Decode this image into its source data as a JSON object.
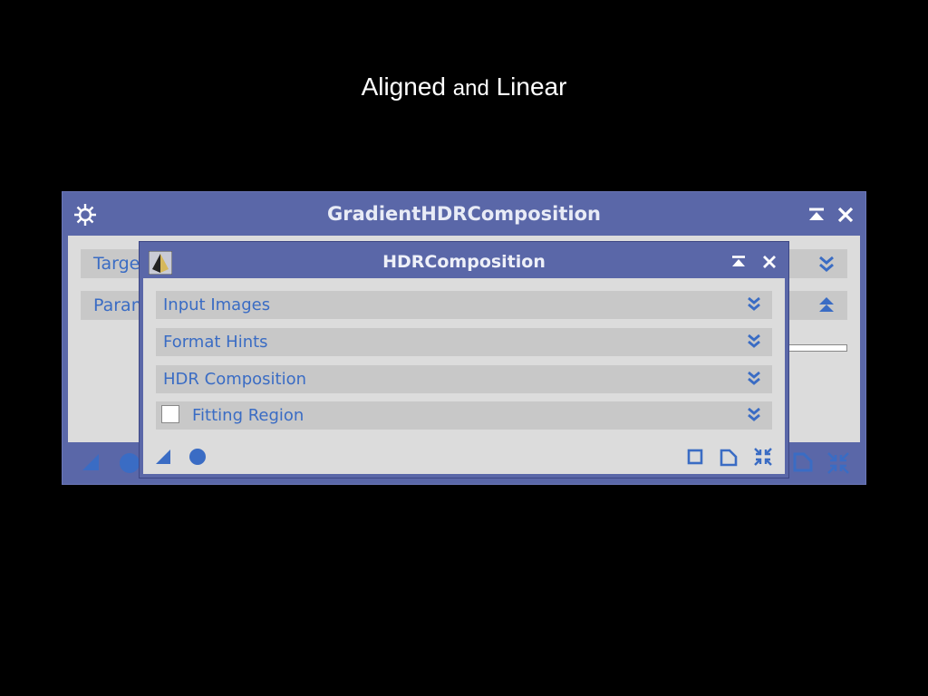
{
  "slide": {
    "title_part1": "Aligned",
    "title_part2": "and",
    "title_part3": "Linear"
  },
  "back_window": {
    "title": "GradientHDRComposition",
    "sections": [
      {
        "label": "Target"
      },
      {
        "label": "Param"
      }
    ]
  },
  "front_window": {
    "title": "HDRComposition",
    "sections": [
      {
        "label": "Input Images"
      },
      {
        "label": "Format Hints"
      },
      {
        "label": "HDR Composition"
      },
      {
        "label": "Fitting Region"
      }
    ]
  },
  "colors": {
    "accent": "#3a6cc4",
    "titlebar": "#5a67a8",
    "panel": "#dcdcdc",
    "section": "#c8c8c8"
  },
  "icons": [
    "gear-icon",
    "shade-icon",
    "close-icon",
    "expand-section-icon",
    "collapse-section-icon",
    "new-instance-icon",
    "apply-global-icon",
    "preview-icon",
    "reset-icon",
    "document-icon",
    "collapse-all-icon"
  ]
}
